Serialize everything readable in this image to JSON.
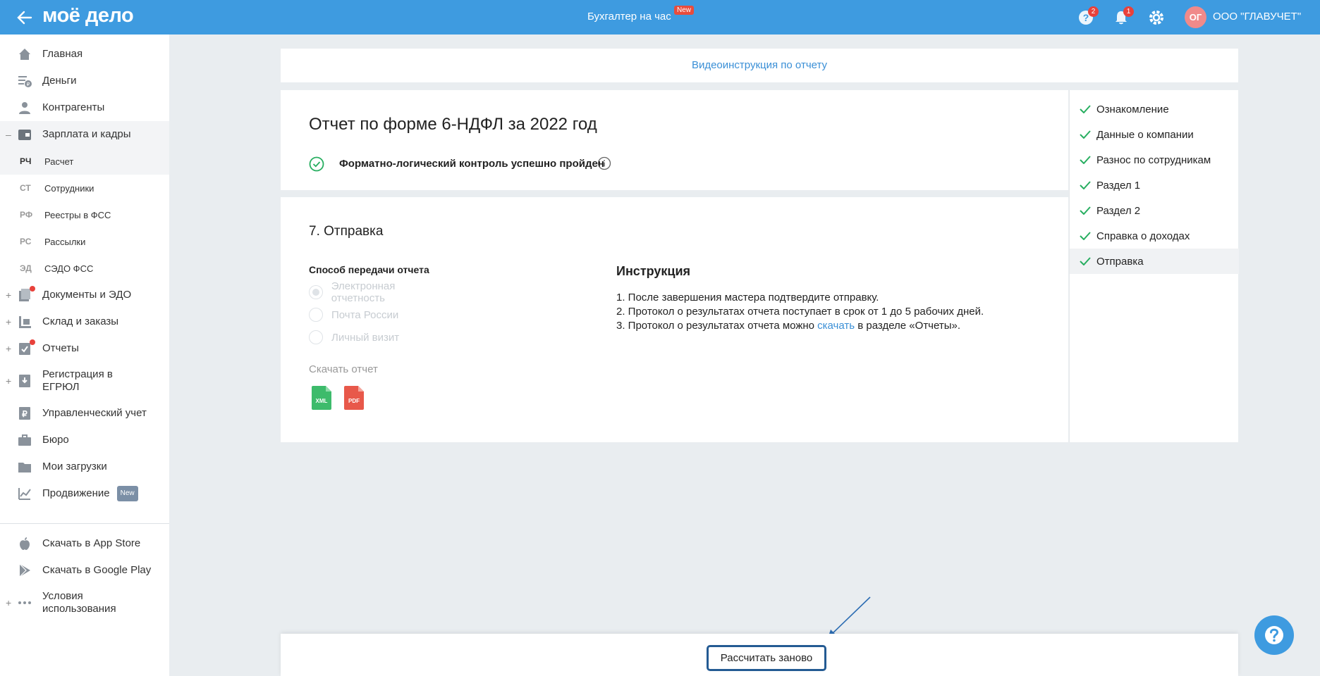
{
  "topbar": {
    "logo": "моё дело",
    "center_link": "Бухгалтер на час",
    "center_badge": "New",
    "help_count": "2",
    "notif_count": "1",
    "org_initials": "ОГ",
    "org_name": "ООО \"ГЛАВУЧЕТ\""
  },
  "sidebar": {
    "items": [
      {
        "label": "Главная",
        "icon": "home-icon"
      },
      {
        "label": "Деньги",
        "icon": "money-icon"
      },
      {
        "label": "Контрагенты",
        "icon": "contractors-icon"
      },
      {
        "label": "Зарплата и кадры",
        "icon": "salary-icon"
      },
      {
        "label": "Документы и ЭДО",
        "icon": "documents-icon"
      },
      {
        "label": "Склад и заказы",
        "icon": "warehouse-icon"
      },
      {
        "label": "Отчеты",
        "icon": "reports-icon"
      },
      {
        "label": "Регистрация в",
        "label2": "ЕГРЮЛ",
        "icon": "registration-icon"
      },
      {
        "label": "Управленческий учет",
        "icon": "management-icon"
      },
      {
        "label": "Бюро",
        "icon": "bureau-icon"
      },
      {
        "label": "Мои загрузки",
        "icon": "downloads-icon"
      },
      {
        "label": "Продвижение",
        "badge": "New",
        "icon": "promotion-icon"
      },
      {
        "label": "Скачать в App Store",
        "icon": "apple-icon"
      },
      {
        "label": "Скачать в Google Play",
        "icon": "google-play-icon"
      },
      {
        "label": "Условия",
        "label2": "использования",
        "icon": "more-icon"
      }
    ],
    "sub_items": [
      {
        "abbr": "РЧ",
        "label": "Расчет"
      },
      {
        "abbr": "СТ",
        "label": "Сотрудники"
      },
      {
        "abbr": "РФ",
        "label": "Реестры в ФСС"
      },
      {
        "abbr": "РС",
        "label": "Рассылки"
      },
      {
        "abbr": "ЭД",
        "label": "СЭДО ФСС"
      }
    ],
    "collapse_sign": "–",
    "expand_sign": "+"
  },
  "main": {
    "video_link": "Видеоинструкция по отчету",
    "report_title": "Отчет по форме 6-НДФЛ за 2022 год",
    "flk_status": "Форматно-логический контроль успешно пройден",
    "section_title": "7. Отправка",
    "method_title": "Способ передачи отчета",
    "methods": [
      "Электронная отчетность",
      "Почта России",
      "Личный визит"
    ],
    "selected_method": "Электронная отчетность",
    "download_label": "Скачать отчет",
    "download_files": [
      "XML",
      "PDF"
    ],
    "instruction_title": "Инструкция",
    "instruction_1": "1. После завершения мастера подтвердите отправку.",
    "instruction_2": "2. Протокол о результатах отчета поступает в срок от 1 до 5 рабочих дней.",
    "instruction_3_pre": "3. Протокол о результатах отчета можно ",
    "instruction_3_link": "скачать",
    "instruction_3_post": " в разделе «Отчеты».",
    "recalc_button": "Рассчитать заново"
  },
  "steps": [
    "Ознакомление",
    "Данные о компании",
    "Разнос по сотрудникам",
    "Раздел 1",
    "Раздел 2",
    "Справка о доходах",
    "Отправка"
  ],
  "current_step": "Отправка",
  "colors": {
    "topbar": "#3e9be0",
    "link": "#3a8fd6",
    "success": "#27ae60",
    "badge": "#e8413b",
    "xml_file": "#3dbb6b",
    "pdf_file": "#e8584a"
  }
}
